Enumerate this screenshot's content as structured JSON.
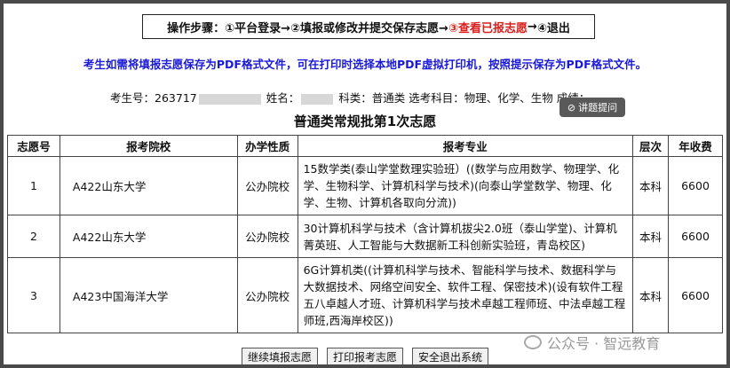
{
  "steps": {
    "prefix": "操作步骤：",
    "step1": "①平台登录→",
    "step2": "②填报或修改并提交保存志愿→",
    "step3": "③查看已报志愿",
    "step3_arrow": "→",
    "step4": "④退出"
  },
  "notice": "考生如需将填报志愿保存为PDF格式文件，可在打印时选择本地PDF虚拟打印机，按照提示保存为PDF格式文件。",
  "info": {
    "examnum_label": "考生号：",
    "examnum_value": "263717",
    "name_label": "姓名：",
    "category_label": "科类：",
    "category_value": "普通类",
    "subjects_label": "选考科目：",
    "subjects_value": "物理、化学、生物",
    "score_label": "成绩："
  },
  "tip_badge": "讲题提问",
  "title": "普通类常规批第1次志愿",
  "table": {
    "headers": [
      "志愿号",
      "报考院校",
      "办学性质",
      "报考专业",
      "层次",
      "年收费"
    ],
    "rows": [
      {
        "no": "1",
        "school": "A422山东大学",
        "type": "公办院校",
        "major": "15数学类(泰山学堂数理实验班）((数学与应用数学、物理学、化学、生物科学、计算机科学与技术)(向泰山学堂数学、物理、化学、生物、计算机各取向分流))",
        "level": "本科",
        "fee": "6600"
      },
      {
        "no": "2",
        "school": "A422山东大学",
        "type": "公办院校",
        "major": "30计算机科学与技术（含计算机拔尖2.0班（泰山学堂)、计算机菁英班、人工智能与大数据新工科创新实验班，青岛校区)",
        "level": "本科",
        "fee": "6600"
      },
      {
        "no": "3",
        "school": "A423中国海洋大学",
        "type": "公办院校",
        "major": "6G计算机类((计算机科学与技术、智能科学与技术、数据科学与大数据技术、网络空间安全、软件工程、保密技术)(设有软件工程五八卓越人才班、计算机科学与技术卓越工程师班、中法卓越工程师班,西海岸校区))",
        "level": "本科",
        "fee": "6600"
      }
    ]
  },
  "buttons": {
    "continue": "继续填报志愿",
    "print": "打印报考志愿",
    "exit": "安全退出系统"
  },
  "watermark": "公众号 · 智远教育"
}
